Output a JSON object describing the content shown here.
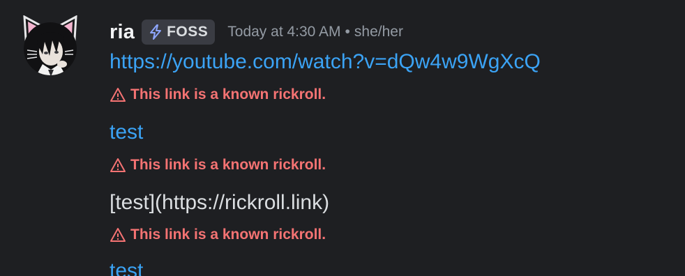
{
  "message": {
    "author": {
      "username": "ria",
      "avatar_icon": "anime-avatar-cat-ears",
      "tag": {
        "icon": "lightning-icon",
        "label": "FOSS"
      }
    },
    "timestamp": "Today at 4:30 AM",
    "separator": "•",
    "pronouns": "she/her",
    "lines": [
      {
        "text": "https://youtube.com/watch?v=dQw4w9WgXcQ",
        "kind": "link"
      },
      {
        "text": "This link is a known rickroll.",
        "kind": "warning"
      },
      {
        "text": "test",
        "kind": "link"
      },
      {
        "text": "This link is a known rickroll.",
        "kind": "warning"
      },
      {
        "text": "[test](https://rickroll.link)",
        "kind": "plain"
      },
      {
        "text": "This link is a known rickroll.",
        "kind": "warning"
      },
      {
        "text": "test",
        "kind": "link"
      }
    ]
  },
  "colors": {
    "background": "#1e1f22",
    "link": "#3ba3f5",
    "warning": "#f57373",
    "muted": "#949ba4",
    "tag_bg": "#3a3c43"
  }
}
